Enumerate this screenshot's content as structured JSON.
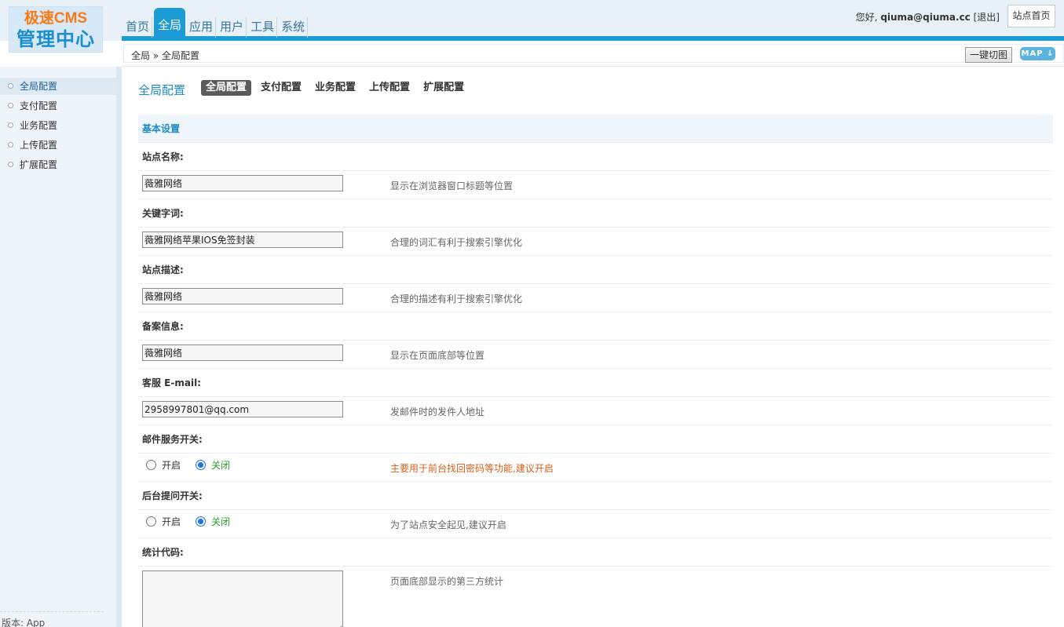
{
  "logo": {
    "line1": "极速CMS",
    "line2": "管理中心"
  },
  "nav": {
    "items": [
      {
        "label": "首页",
        "active": false
      },
      {
        "label": "全局",
        "active": true
      },
      {
        "label": "应用",
        "active": false
      },
      {
        "label": "用户",
        "active": false
      },
      {
        "label": "工具",
        "active": false
      },
      {
        "label": "系统",
        "active": false
      }
    ]
  },
  "header": {
    "greeting": "您好,",
    "username": "qiuma@qiuma.cc",
    "logout": "[退出]",
    "site_home": "站点首页"
  },
  "breadcrumb": {
    "text": "全局 » 全局配置"
  },
  "toolbar": {
    "screenshot_label": "一键切图",
    "map_label": "MAP ↓"
  },
  "sidebar": {
    "items": [
      {
        "label": "全局配置",
        "active": true
      },
      {
        "label": "支付配置",
        "active": false
      },
      {
        "label": "业务配置",
        "active": false
      },
      {
        "label": "上传配置",
        "active": false
      },
      {
        "label": "扩展配置",
        "active": false
      }
    ],
    "version": "版本: App"
  },
  "main": {
    "title": "全局配置",
    "tabs": [
      {
        "label": "全局配置",
        "active": true
      },
      {
        "label": "支付配置",
        "active": false
      },
      {
        "label": "业务配置",
        "active": false
      },
      {
        "label": "上传配置",
        "active": false
      },
      {
        "label": "扩展配置",
        "active": false
      }
    ],
    "section_title": "基本设置",
    "fields": {
      "site_name": {
        "label": "站点名称:",
        "value": "薇雅网络",
        "hint": "显示在浏览器窗口标题等位置"
      },
      "keywords": {
        "label": "关键字词:",
        "value": "薇雅网络苹果IOS免签封装",
        "hint": "合理的词汇有利于搜索引擎优化"
      },
      "description": {
        "label": "站点描述:",
        "value": "薇雅网络",
        "hint": "合理的描述有利于搜索引擎优化"
      },
      "icp": {
        "label": "备案信息:",
        "value": "薇雅网络",
        "hint": "显示在页面底部等位置"
      },
      "email": {
        "label": "客服 E-mail:",
        "value": "2958997801@qq.com",
        "hint": "发邮件时的发件人地址"
      },
      "mail_switch": {
        "label": "邮件服务开关:",
        "on_label": "开启",
        "off_label": "关闭",
        "selected": "关闭",
        "hint": "主要用于前台找回密码等功能,建议开启"
      },
      "admin_question": {
        "label": "后台提问开关:",
        "on_label": "开启",
        "off_label": "关闭",
        "selected": "关闭",
        "hint": "为了站点安全起见,建议开启"
      },
      "stats_code": {
        "label": "统计代码:",
        "value": "",
        "hint": "页面底部显示的第三方统计"
      }
    }
  },
  "colors": {
    "accent": "#1d9bd5",
    "title_blue": "#1e8bc3",
    "logo_orange": "#f77a14",
    "warn": "#d9601a",
    "on_green": "#2b9c2b"
  }
}
